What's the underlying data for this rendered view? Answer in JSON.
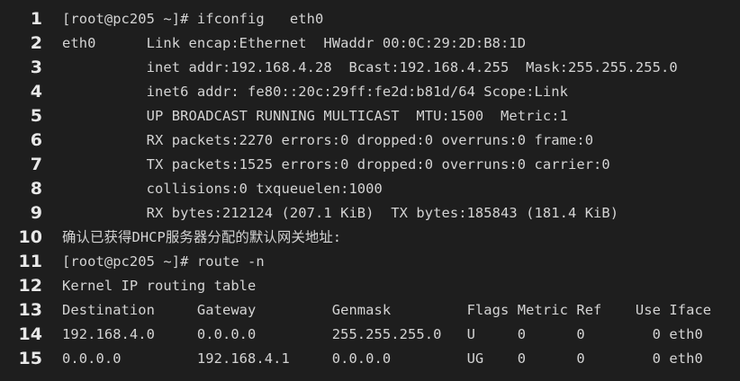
{
  "lines": [
    {
      "n": "1",
      "text": "[root@pc205 ~]# ifconfig   eth0"
    },
    {
      "n": "2",
      "text": "eth0      Link encap:Ethernet  HWaddr 00:0C:29:2D:B8:1D"
    },
    {
      "n": "3",
      "text": "          inet addr:192.168.4.28  Bcast:192.168.4.255  Mask:255.255.255.0"
    },
    {
      "n": "4",
      "text": "          inet6 addr: fe80::20c:29ff:fe2d:b81d/64 Scope:Link"
    },
    {
      "n": "5",
      "text": "          UP BROADCAST RUNNING MULTICAST  MTU:1500  Metric:1"
    },
    {
      "n": "6",
      "text": "          RX packets:2270 errors:0 dropped:0 overruns:0 frame:0"
    },
    {
      "n": "7",
      "text": "          TX packets:1525 errors:0 dropped:0 overruns:0 carrier:0"
    },
    {
      "n": "8",
      "text": "          collisions:0 txqueuelen:1000"
    },
    {
      "n": "9",
      "text": "          RX bytes:212124 (207.1 KiB)  TX bytes:185843 (181.4 KiB)"
    },
    {
      "n": "10",
      "text": "确认已获得DHCP服务器分配的默认网关地址:"
    },
    {
      "n": "11",
      "text": "[root@pc205 ~]# route -n"
    },
    {
      "n": "12",
      "text": "Kernel IP routing table"
    },
    {
      "n": "13",
      "text": "Destination     Gateway         Genmask         Flags Metric Ref    Use Iface"
    },
    {
      "n": "14",
      "text": "192.168.4.0     0.0.0.0         255.255.255.0   U     0      0        0 eth0"
    },
    {
      "n": "15",
      "text": "0.0.0.0         192.168.4.1     0.0.0.0         UG    0      0        0 eth0"
    }
  ],
  "colors": {
    "background": "#1e1e1e",
    "text": "#d4d4d4",
    "line_number": "#e8e8e8"
  }
}
